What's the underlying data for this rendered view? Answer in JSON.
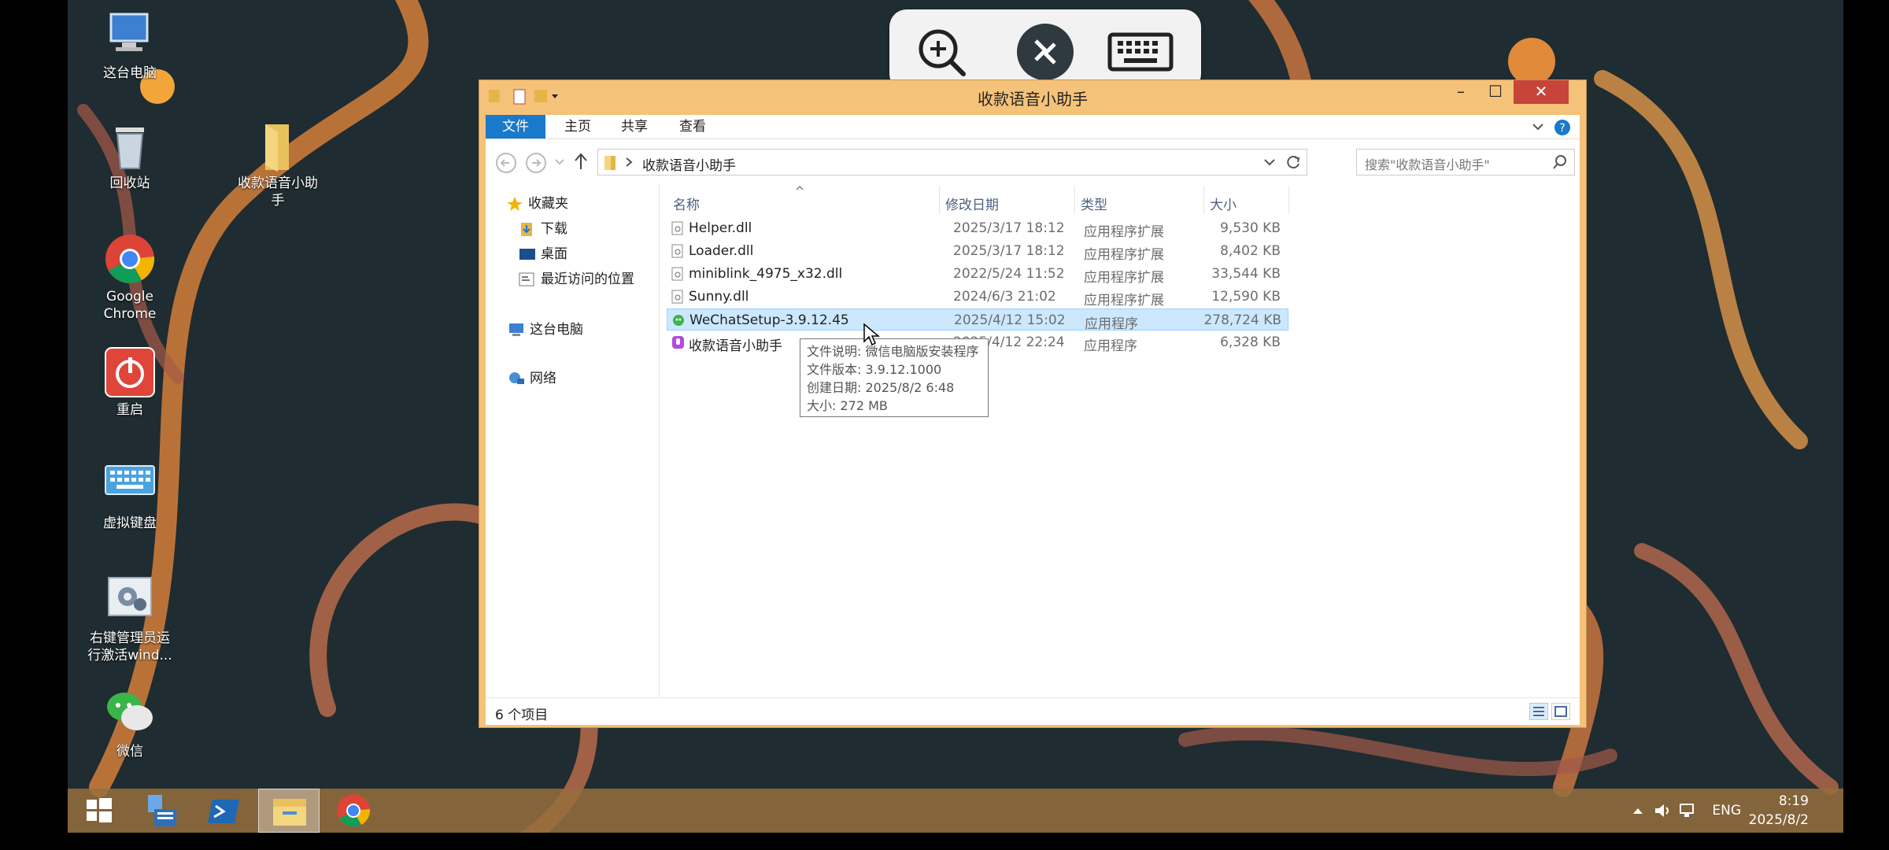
{
  "desktop": {
    "icons": [
      {
        "label": "这台电脑"
      },
      {
        "label": "回收站"
      },
      {
        "label": "收款语音小助手"
      },
      {
        "label": "Google Chrome"
      },
      {
        "label": "重启"
      },
      {
        "label": "虚拟键盘"
      },
      {
        "label": "右键管理员运行激活wind..."
      },
      {
        "label": "微信"
      }
    ]
  },
  "window": {
    "title": "收款语音小助手",
    "controls": {
      "minimize": "–",
      "maximize": "☐",
      "close": "✕"
    },
    "ribbon_tabs": [
      "文件",
      "主页",
      "共享",
      "查看"
    ],
    "address": {
      "path": "收款语音小助手"
    },
    "search": {
      "placeholder": "搜索\"收款语音小助手\""
    },
    "nav": {
      "favorites": "收藏夹",
      "downloads": "下载",
      "desktop": "桌面",
      "recent": "最近访问的位置",
      "this_pc": "这台电脑",
      "network": "网络"
    },
    "columns": {
      "name": "名称",
      "date": "修改日期",
      "type": "类型",
      "size": "大小"
    },
    "files": [
      {
        "name": "Helper.dll",
        "date": "2025/3/17 18:12",
        "type": "应用程序扩展",
        "size": "9,530 KB"
      },
      {
        "name": "Loader.dll",
        "date": "2025/3/17 18:12",
        "type": "应用程序扩展",
        "size": "8,402 KB"
      },
      {
        "name": "miniblink_4975_x32.dll",
        "date": "2022/5/24 11:52",
        "type": "应用程序扩展",
        "size": "33,544 KB"
      },
      {
        "name": "Sunny.dll",
        "date": "2024/6/3 21:02",
        "type": "应用程序扩展",
        "size": "12,590 KB"
      },
      {
        "name": "WeChatSetup-3.9.12.45",
        "date": "2025/4/12 15:02",
        "type": "应用程序",
        "size": "278,724 KB"
      },
      {
        "name": "收款语音小助手",
        "date": "2025/4/12 22:24",
        "type": "应用程序",
        "size": "6,328 KB"
      }
    ],
    "tooltip": {
      "line1": "文件说明: 微信电脑版安装程序",
      "line2": "文件版本: 3.9.12.1000",
      "line3": "创建日期: 2025/8/2 6:48",
      "line4": "大小: 272 MB"
    },
    "status": "6 个项目"
  },
  "taskbar": {
    "lang": "ENG",
    "time": "8:19",
    "date": "2025/8/2"
  }
}
